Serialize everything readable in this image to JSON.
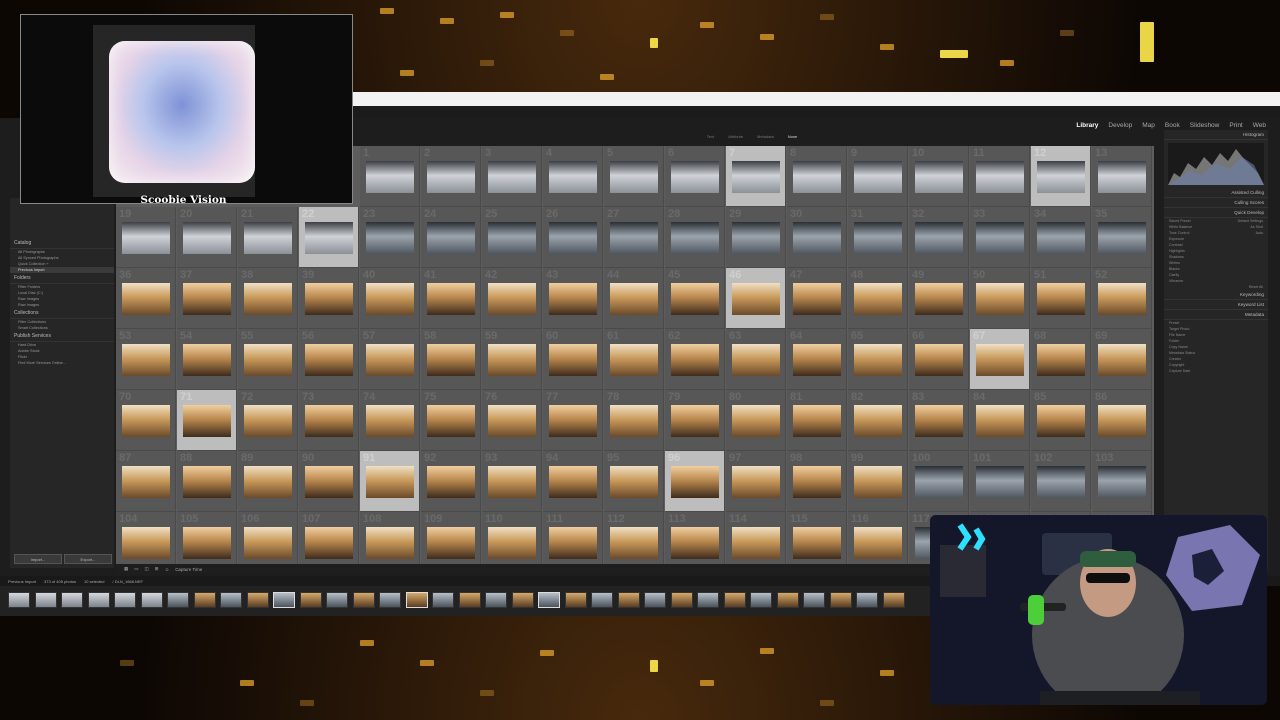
{
  "overlay": {
    "brand_text": "Scoobie Vision"
  },
  "lightroom": {
    "modules": [
      "Library",
      "Develop",
      "Map",
      "Book",
      "Slideshow",
      "Print",
      "Web"
    ],
    "active_module": "Library",
    "filter_tabs": [
      "Text",
      "Attribute",
      "Metadata",
      "None"
    ],
    "left_panel": {
      "catalog_title": "Catalog",
      "catalog_items": [
        "All Photographs",
        "All Synced Photographs",
        "Quick Collection +",
        "Previous Import"
      ],
      "folders_title": "Folders",
      "folders_items": [
        "Filter Folders",
        "Local Disk (C:)",
        "Raw Images",
        "Raw Images"
      ],
      "collections_title": "Collections",
      "collections_items": [
        "Filter Collections",
        "Smart Collections"
      ],
      "publish_title": "Publish Services",
      "publish_items": [
        "Hard Drive",
        "Adobe Stock",
        "Flickr",
        "Find More Services Online..."
      ],
      "import_label": "Import...",
      "export_label": "Export..."
    },
    "right_panel": {
      "histogram_title": "Histogram",
      "assisted_culling": "Assisted Culling",
      "culling_scores": "Culling Scores",
      "quick_develop": "Quick Develop",
      "saved_preset_label": "Saved Preset",
      "saved_preset_value": "Default Settings",
      "white_balance_label": "White Balance",
      "white_balance_value": "As Shot",
      "tone_control": "Tone Control",
      "auto": "Auto",
      "tone_rows": [
        "Exposure",
        "Contrast",
        "Highlights",
        "Shadows",
        "Whites",
        "Blacks",
        "Clarity",
        "Vibrance"
      ],
      "reset_all": "Reset All",
      "keywording": "Keywording",
      "keyword_list": "Keyword List",
      "metadata": "Metadata",
      "metadata_rows": [
        "Preset",
        "Target Photo",
        "File Name",
        "Folder",
        "Copy Name",
        "Metadata Status",
        "Creator",
        "Copyright",
        "Capture Date"
      ]
    },
    "grid": {
      "rows": [
        {
          "start": 1,
          "count": 13,
          "selected": [
            7,
            12
          ]
        },
        {
          "start": 19,
          "count": 17,
          "selected": [
            22
          ]
        },
        {
          "start": 36,
          "count": 17,
          "selected": [
            46
          ]
        },
        {
          "start": 53,
          "count": 17,
          "selected": [
            67
          ]
        },
        {
          "start": 70,
          "count": 17,
          "selected": [
            71
          ]
        },
        {
          "start": 87,
          "count": 17,
          "selected": [
            91,
            96
          ]
        },
        {
          "start": 104,
          "count": 17,
          "selected": []
        }
      ]
    },
    "toolbar": {
      "sort_label": "Capture Time"
    },
    "filmstrip": {
      "source_label": "Previous Import",
      "count_label": "373 of 405 photos",
      "selected_label": "10 selected",
      "file_label": "/ DLN_1668.NEF"
    }
  }
}
